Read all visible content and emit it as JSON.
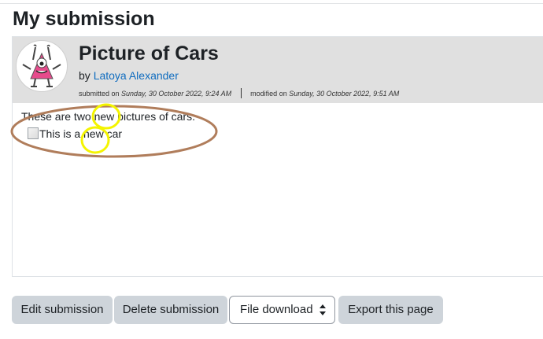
{
  "page": {
    "title": "My submission"
  },
  "submission": {
    "title": "Picture of Cars",
    "by_prefix": "by",
    "author": "Latoya Alexander",
    "submitted_label": "submitted on",
    "submitted_date": "Sunday, 30 October 2022, 9:24 AM",
    "modified_label": "modified on",
    "modified_date": "Sunday, 30 October 2022, 9:51 AM",
    "body_text": "These are two new pictures of cars.",
    "image_alt": "This is a new car"
  },
  "actions": {
    "edit_label": "Edit submission",
    "delete_label": "Delete submission",
    "download_select": {
      "selected": "File download"
    },
    "export_label": "Export this page"
  },
  "colors": {
    "link": "#0f6cbf",
    "header_bg": "#e0e0e0",
    "button_bg": "#ced4da",
    "annotation_brown": "#b07d5b",
    "annotation_yellow": "#f4f400"
  }
}
